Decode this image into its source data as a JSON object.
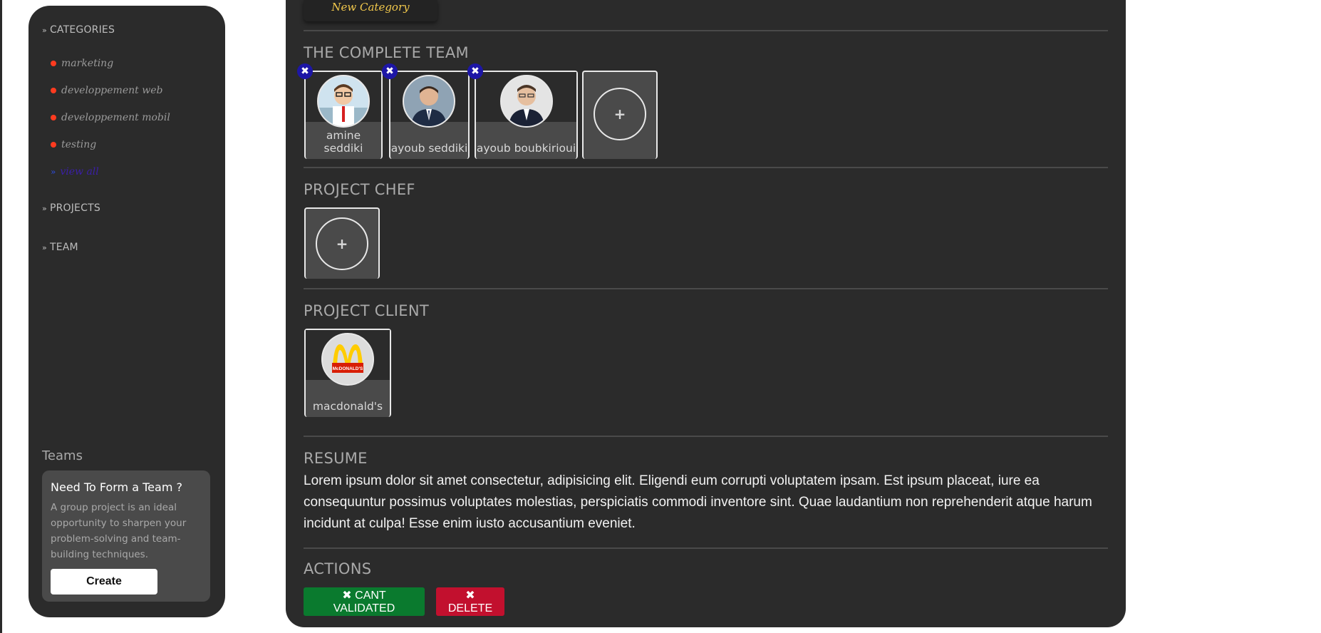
{
  "sidebar": {
    "categories_label": "CATEGORIES",
    "categories": [
      {
        "label": "marketing"
      },
      {
        "label": "developpement web"
      },
      {
        "label": "developpement mobil"
      },
      {
        "label": "testing"
      }
    ],
    "see_all_label": "view all",
    "projects_label": "PROJECTS",
    "team_label": "TEAM",
    "teams_title": "Teams",
    "team_card": {
      "title": "Need To Form a Team ?",
      "text": "A group project is an ideal opportunity to sharpen your problem-solving and team-building techniques.",
      "button": "Create"
    }
  },
  "main": {
    "new_category_label": "New Category",
    "complete_team": {
      "title": "THE COMPLETE TEAM",
      "members": [
        {
          "name": "amine seddiki"
        },
        {
          "name": "ayoub seddiki"
        },
        {
          "name": "ayoub boubkirioui"
        }
      ],
      "add_symbol": "+"
    },
    "project_chef": {
      "title": "PROJECT CHEF",
      "add_symbol": "+"
    },
    "project_client": {
      "title": "PROJECT CLIENT",
      "client_name": "macdonald's",
      "logo_text": "McDONALD'S"
    },
    "resume": {
      "title": "RESUME",
      "text": "Lorem ipsum dolor sit amet consectetur, adipisicing elit. Eligendi eum corrupti voluptatem ipsam. Est ipsum placeat, iure ea consequuntur possimus voluptates molestias, perspiciatis commodi inventore sint. Quae laudantium non reprehenderit atque harum incidunt at culpa! Esse enim iusto accusantium eveniet."
    },
    "actions": {
      "title": "ACTIONS",
      "validate_label": "CANT VALIDATED",
      "delete_label": "DELETE"
    }
  },
  "icons": {
    "section_chevron": "double-chevron-icon",
    "remove": "close-x-icon",
    "add": "plus-icon"
  },
  "colors": {
    "panel_bg": "#2b2b2b",
    "card_bg": "#4a4a4a",
    "category_dot": "#ff3b1f",
    "remove_badge": "#1d16a6",
    "validate_green": "#0a7a2e",
    "delete_red": "#c2102e",
    "new_category_text": "#f2c94c"
  }
}
